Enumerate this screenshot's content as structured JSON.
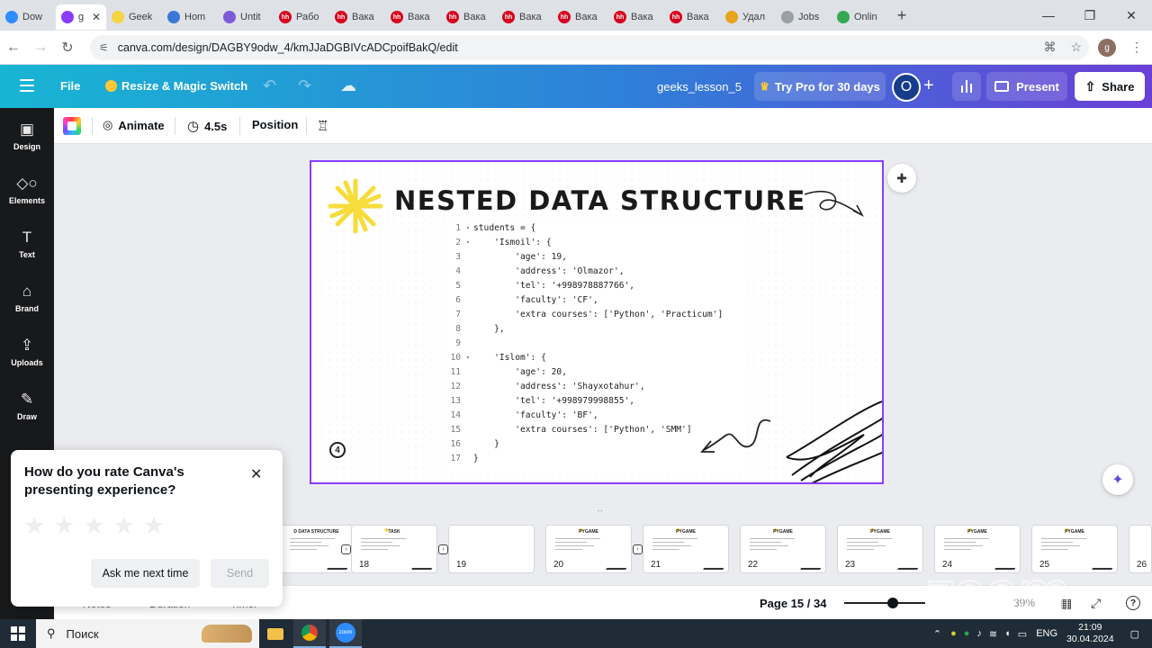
{
  "browser": {
    "tabs": [
      {
        "label": "Dow",
        "icon": "zoom-icon",
        "color": "#2d8cff"
      },
      {
        "label": "g",
        "icon": "canva-icon",
        "color": "#8b3dff",
        "active": true
      },
      {
        "label": "Geek",
        "icon": "star-icon",
        "color": "#f5d442"
      },
      {
        "label": "Hom",
        "icon": "chrome-icon",
        "color": "#3c78d8"
      },
      {
        "label": "Untit",
        "icon": "colab-icon",
        "color": "#7b5cd6"
      },
      {
        "label": "Рабо",
        "icon": "hh-icon",
        "color": "#d6001c"
      },
      {
        "label": "Вака",
        "icon": "hh-icon",
        "color": "#d6001c"
      },
      {
        "label": "Вака",
        "icon": "hh-icon",
        "color": "#d6001c"
      },
      {
        "label": "Вака",
        "icon": "hh-icon",
        "color": "#d6001c"
      },
      {
        "label": "Вака",
        "icon": "hh-icon",
        "color": "#d6001c"
      },
      {
        "label": "Вака",
        "icon": "hh-icon",
        "color": "#d6001c"
      },
      {
        "label": "Вака",
        "icon": "hh-icon",
        "color": "#d6001c"
      },
      {
        "label": "Вака",
        "icon": "hh-icon",
        "color": "#d6001c"
      },
      {
        "label": "Удал",
        "icon": "hat-icon",
        "color": "#e6a41a"
      },
      {
        "label": "Jobs",
        "icon": "cloud-icon",
        "color": "#9aa0a6"
      },
      {
        "label": "Onlin",
        "icon": "shield-icon",
        "color": "#34a853"
      }
    ],
    "url": "canva.com/design/DAGBY9odw_4/kmJJaDGBIVcADCpoifBakQ/edit",
    "profile_letter": "g",
    "hh_text": "hh"
  },
  "canva": {
    "file": "File",
    "resize": "Resize & Magic Switch",
    "doc_title": "geeks_lesson_5",
    "try_pro": "Try Pro for 30 days",
    "avatar_letter": "O",
    "present": "Present",
    "share": "Share"
  },
  "sidebar": {
    "items": [
      {
        "label": "Design",
        "icon": "design-icon"
      },
      {
        "label": "Elements",
        "icon": "elements-icon"
      },
      {
        "label": "Text",
        "icon": "text-icon"
      },
      {
        "label": "Brand",
        "icon": "brand-icon"
      },
      {
        "label": "Uploads",
        "icon": "uploads-icon"
      },
      {
        "label": "Draw",
        "icon": "draw-icon"
      }
    ],
    "text_glyph": "T"
  },
  "toolbar": {
    "animate": "Animate",
    "duration": "4.5s",
    "position": "Position"
  },
  "slide": {
    "title": "NESTED DATA STRUCTURE",
    "page_mark": "4",
    "code": [
      {
        "n": "1",
        "fold": true,
        "text": "students = {"
      },
      {
        "n": "2",
        "fold": true,
        "text": "    'Ismoil': {"
      },
      {
        "n": "3",
        "fold": false,
        "text": "        'age': 19,"
      },
      {
        "n": "4",
        "fold": false,
        "text": "        'address': 'Olmazor',"
      },
      {
        "n": "5",
        "fold": false,
        "text": "        'tel': '+998978887766',"
      },
      {
        "n": "6",
        "fold": false,
        "text": "        'faculty': 'CF',"
      },
      {
        "n": "7",
        "fold": false,
        "text": "        'extra courses': ['Python', 'Practicum']"
      },
      {
        "n": "8",
        "fold": false,
        "text": "    },"
      },
      {
        "n": "9",
        "fold": false,
        "text": ""
      },
      {
        "n": "10",
        "fold": true,
        "text": "    'Islom': {"
      },
      {
        "n": "11",
        "fold": false,
        "text": "        'age': 20,"
      },
      {
        "n": "12",
        "fold": false,
        "text": "        'address': 'Shayxotahur',"
      },
      {
        "n": "13",
        "fold": false,
        "text": "        'tel': '+998979998855',"
      },
      {
        "n": "14",
        "fold": false,
        "text": "        'faculty': 'BF',"
      },
      {
        "n": "15",
        "fold": false,
        "text": "        'extra courses': ['Python', 'SMM']"
      },
      {
        "n": "16",
        "fold": false,
        "text": "    }"
      },
      {
        "n": "17",
        "fold": false,
        "text": "}"
      }
    ]
  },
  "thumbnails": [
    {
      "num": "",
      "title": "D DATA STRUCTURE"
    },
    {
      "num": "18",
      "title": "TASK"
    },
    {
      "num": "19",
      "title": ""
    },
    {
      "num": "20",
      "title": "PYGAME"
    },
    {
      "num": "21",
      "title": "PYGAME"
    },
    {
      "num": "22",
      "title": "PYGAME"
    },
    {
      "num": "23",
      "title": "PYGAME"
    },
    {
      "num": "24",
      "title": "PYGAME"
    },
    {
      "num": "25",
      "title": "PYGAME"
    },
    {
      "num": "26",
      "title": ""
    }
  ],
  "footer": {
    "page": "Page 15 / 34",
    "zoom": "39%",
    "zoom_fraction": 0.6,
    "notes": "Notes",
    "duration": "Duration",
    "timer": "Timer",
    "zoom_watermark": "zoom"
  },
  "rating_popup": {
    "title": "How do you rate Canva's presenting experience?",
    "later": "Ask me next time",
    "send": "Send",
    "star_count": 5
  },
  "taskbar": {
    "search": "Поиск",
    "language": "ENG",
    "time": "21:09",
    "date": "30.04.2024"
  }
}
